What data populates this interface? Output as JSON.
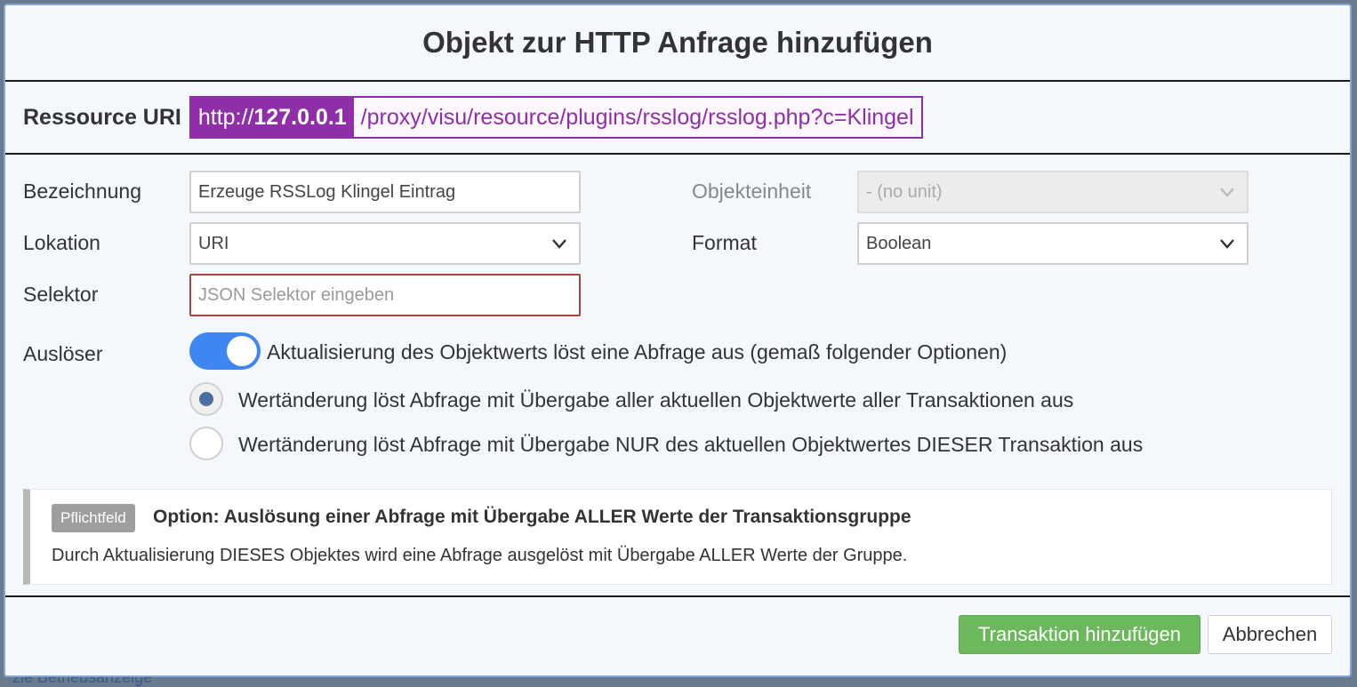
{
  "dialog": {
    "title": "Objekt zur HTTP Anfrage hinzufügen"
  },
  "resource": {
    "label": "Ressource URI",
    "base_prefix": "http://",
    "base_host": "127.0.0.1",
    "path": "/proxy/visu/resource/plugins/rsslog/rsslog.php?c=Klingel"
  },
  "form": {
    "bezeichnung": {
      "label": "Bezeichnung",
      "value": "Erzeuge RSSLog Klingel Eintrag"
    },
    "lokation": {
      "label": "Lokation",
      "value": "URI"
    },
    "selektor": {
      "label": "Selektor",
      "placeholder": "JSON Selektor eingeben"
    },
    "objekteinheit": {
      "label": "Objekteinheit",
      "value": "- (no unit)"
    },
    "format": {
      "label": "Format",
      "value": "Boolean"
    },
    "ausloeser": {
      "label": "Auslöser",
      "toggle_on": true,
      "toggle_text": "Aktualisierung des Objektwerts löst eine Abfrage aus (gemaß folgender Optionen)",
      "options": [
        {
          "text": "Wertänderung löst Abfrage mit Übergabe aller aktuellen Objektwerte aller Transaktionen aus",
          "checked": true
        },
        {
          "text": "Wertänderung löst Abfrage mit Übergabe NUR des aktuellen Objektwertes DIESER Transaktion aus",
          "checked": false
        }
      ]
    }
  },
  "info": {
    "badge": "Pflichtfeld",
    "title": "Option: Auslösung einer Abfrage mit Übergabe ALLER Werte der Transaktionsgruppe",
    "text": "Durch Aktualisierung DIESES Objektes wird eine Abfrage ausgelöst mit Übergabe ALLER Werte der Gruppe."
  },
  "footer": {
    "primary_label": "Transaktion hinzufügen",
    "cancel_label": "Abbrechen"
  },
  "backdrop": {
    "text": "zle Betriebsanzeige"
  },
  "colors": {
    "uri_accent": "#8e2fa8",
    "toggle_on": "#3f86f2",
    "primary_button": "#6cb85c",
    "radio_dot": "#4a6fa5",
    "error_border": "#a94442"
  },
  "icons": {
    "select_arrow": "chevron-down-icon"
  }
}
